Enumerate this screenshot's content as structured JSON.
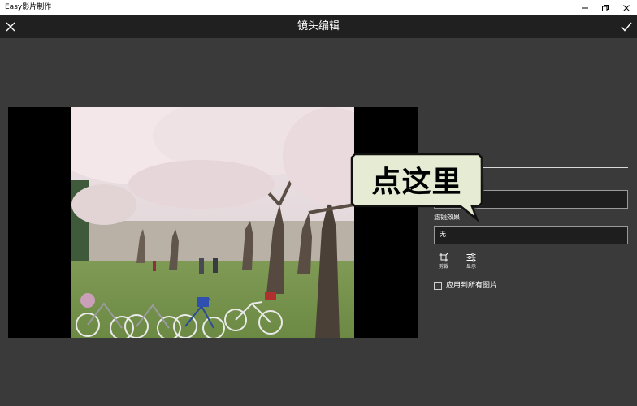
{
  "app": {
    "title": "Easy影片制作"
  },
  "header": {
    "title": "镜头编辑"
  },
  "panel": {
    "text_field_value": "",
    "filter_label": "滤镜效果",
    "filter_value": "无",
    "tools": [
      {
        "label": "剪裁",
        "icon": "crop-icon"
      },
      {
        "label": "显示",
        "icon": "sliders-icon"
      }
    ],
    "apply_all_label": "应用到所有图片",
    "apply_all_checked": false
  },
  "callout": {
    "text": "点这里"
  },
  "colors": {
    "background": "#3a3a3a",
    "header": "#202020",
    "field": "#1e1e1e",
    "callout_fill": "#e6ecd3"
  }
}
